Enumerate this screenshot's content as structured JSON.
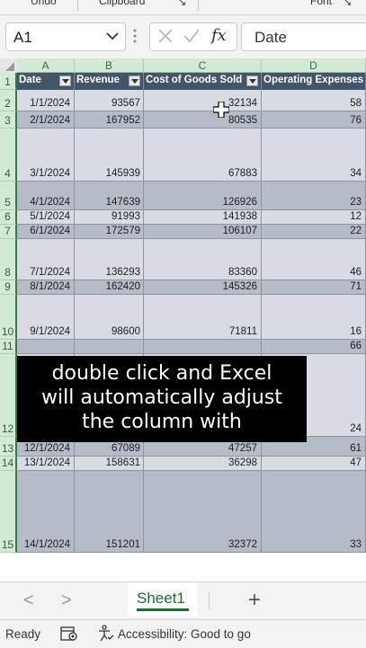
{
  "ribbon": {
    "undo_label": "Undo",
    "clipboard_label": "Clipboard",
    "font_label": "Font"
  },
  "formula_bar": {
    "name_box": "A1",
    "cancel_icon": "close-icon",
    "enter_icon": "check-icon",
    "fx_label": "fx",
    "content": "Date"
  },
  "grid": {
    "column_headers": [
      "A",
      "B",
      "C",
      "D"
    ],
    "table_headers": [
      "Date",
      "Revenue",
      "Cost of Goods Sold",
      "Operating Expenses"
    ],
    "rows": [
      {
        "num": "2",
        "date": "1/1/2024",
        "revenue": "93567",
        "cogs": "32134",
        "opex": "58"
      },
      {
        "num": "3",
        "date": "2/1/2024",
        "revenue": "167952",
        "cogs": "80535",
        "opex": "76"
      },
      {
        "num": "4",
        "date": "3/1/2024",
        "revenue": "145939",
        "cogs": "67883",
        "opex": "34"
      },
      {
        "num": "5",
        "date": "4/1/2024",
        "revenue": "147639",
        "cogs": "126926",
        "opex": "23"
      },
      {
        "num": "6",
        "date": "5/1/2024",
        "revenue": "91993",
        "cogs": "141938",
        "opex": "12"
      },
      {
        "num": "7",
        "date": "6/1/2024",
        "revenue": "172579",
        "cogs": "106107",
        "opex": "22"
      },
      {
        "num": "8",
        "date": "7/1/2024",
        "revenue": "136293",
        "cogs": "83360",
        "opex": "46"
      },
      {
        "num": "9",
        "date": "8/1/2024",
        "revenue": "162420",
        "cogs": "145326",
        "opex": "71"
      },
      {
        "num": "10",
        "date": "9/1/2024",
        "revenue": "98600",
        "cogs": "71811",
        "opex": "16"
      },
      {
        "num": "11",
        "date": "",
        "revenue": "",
        "cogs": "",
        "opex": "66"
      },
      {
        "num": "12",
        "date": "",
        "revenue": "",
        "cogs": "",
        "opex": "24"
      },
      {
        "num": "13",
        "date": "12/1/2024",
        "revenue": "67089",
        "cogs": "47257",
        "opex": "61"
      },
      {
        "num": "14",
        "date": "13/1/2024",
        "revenue": "158631",
        "cogs": "36298",
        "opex": "47"
      },
      {
        "num": "15",
        "date": "14/1/2024",
        "revenue": "151201",
        "cogs": "32372",
        "opex": "33"
      }
    ]
  },
  "caption": {
    "lines": [
      "double click and Excel",
      "will automatically adjust",
      "the column with"
    ]
  },
  "sheet_tabs": {
    "active": "Sheet1",
    "add_label": "+",
    "prev_label": "<",
    "next_label": ">"
  },
  "status_bar": {
    "ready": "Ready",
    "accessibility": "Accessibility: Good to go"
  },
  "colors": {
    "header_fill": "#44546a",
    "band_dark": "#b6bcc7",
    "band_light": "#d8dbe1",
    "accent_green": "#1d6b2e"
  }
}
